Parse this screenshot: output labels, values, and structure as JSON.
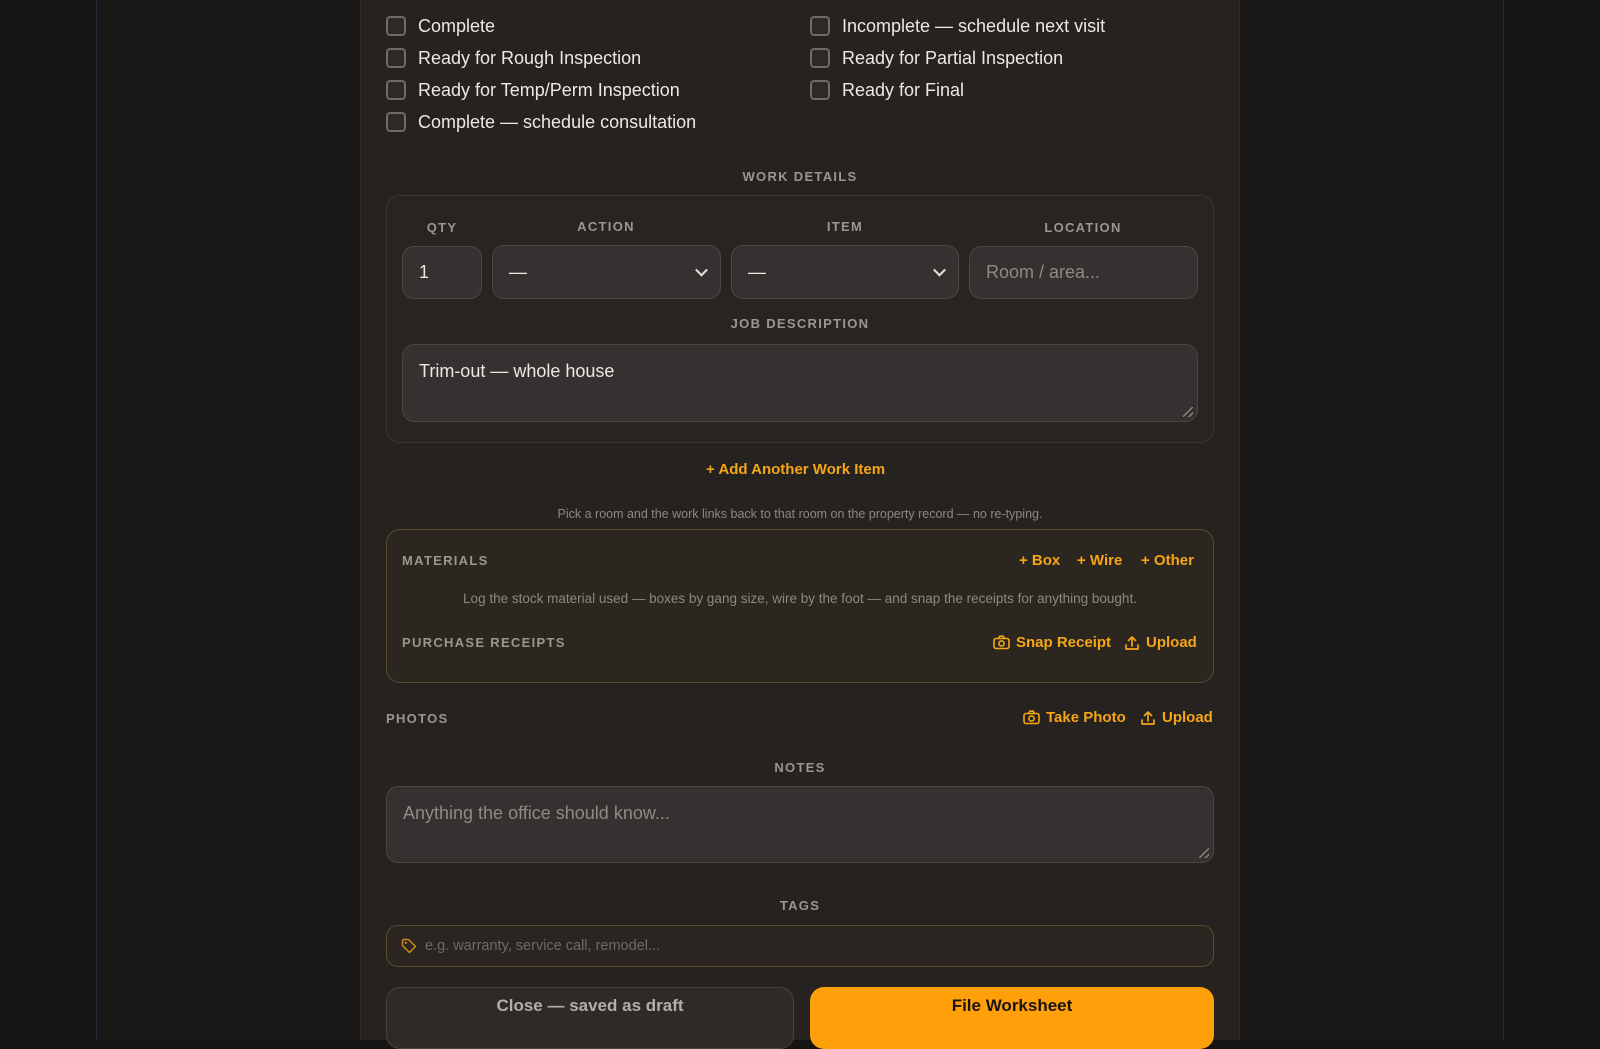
{
  "status_options": [
    {
      "label": "Complete"
    },
    {
      "label": "Incomplete — schedule next visit"
    },
    {
      "label": "Ready for Rough Inspection"
    },
    {
      "label": "Ready for Partial Inspection"
    },
    {
      "label": "Ready for Temp/Perm Inspection"
    },
    {
      "label": "Ready for Final"
    },
    {
      "label": "Complete — schedule consultation"
    }
  ],
  "work_details": {
    "heading": "WORK DETAILS",
    "qty_label": "QTY",
    "action_label": "ACTION",
    "item_label": "ITEM",
    "location_label": "LOCATION",
    "qty_value": "1",
    "action_value": "—",
    "item_value": "—",
    "location_placeholder": "Room / area...",
    "job_description_label": "JOB DESCRIPTION",
    "job_description_value": "Trim-out — whole house"
  },
  "add_work_item": "+ Add Another Work Item",
  "room_hint": "Pick a room and the work links back to that room on the property record — no re-typing.",
  "materials": {
    "heading": "MATERIALS",
    "add_box": "+ Box",
    "add_wire": "+ Wire",
    "add_other": "+ Other",
    "hint": "Log the stock material used — boxes by gang size, wire by the foot — and snap the receipts for anything bought.",
    "receipts_heading": "PURCHASE RECEIPTS",
    "snap_receipt": "Snap Receipt",
    "upload": "Upload"
  },
  "photos": {
    "heading": "PHOTOS",
    "take_photo": "Take Photo",
    "upload": "Upload"
  },
  "notes": {
    "heading": "NOTES",
    "placeholder": "Anything the office should know..."
  },
  "tags": {
    "heading": "TAGS",
    "placeholder": "e.g. warranty, service call, remodel..."
  },
  "actions": {
    "draft": "Close — saved as draft",
    "file": "File Worksheet"
  },
  "colors": {
    "accent": "#f5a515",
    "primary_button": "#ff9f0a",
    "background": "#161514",
    "card": "#252220"
  },
  "icons": {
    "camera": "camera-icon",
    "upload": "upload-icon",
    "tag": "tag-icon",
    "chevron": "chevron-down-icon"
  }
}
